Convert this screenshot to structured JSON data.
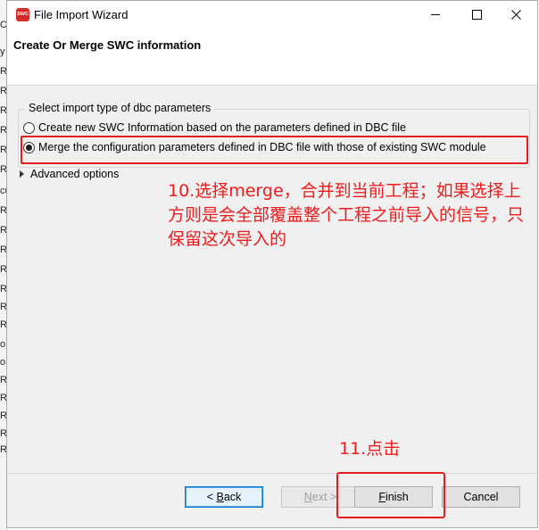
{
  "left_strip": {
    "fragments": [
      "C",
      "y",
      "R",
      "R",
      "R",
      "R",
      "R",
      "R",
      "cu",
      "R",
      "R",
      "R",
      "R",
      "R",
      "R",
      "R",
      "o",
      "o",
      "R",
      "R",
      "R",
      "R",
      "R"
    ]
  },
  "window": {
    "title": "File Import Wizard",
    "icon_text": "SWC"
  },
  "header": {
    "title": "Create Or Merge SWC information"
  },
  "import_group": {
    "label": "Select import type of dbc parameters",
    "options": [
      {
        "label": "Create new SWC Information based on the parameters defined in DBC file",
        "selected": false
      },
      {
        "label": "Merge the configuration parameters defined in DBC file with those of existing SWC module",
        "selected": true
      }
    ]
  },
  "advanced": {
    "label": "Advanced options"
  },
  "annotations": {
    "step10": "10.选择merge，合并到当前工程；如果选择上方则是会全部覆盖整个工程之前导入的信号，只保留这次导入的",
    "step11": "11.点击",
    "color": "#e51c1c"
  },
  "buttons": {
    "back_mnemonic": "B",
    "back_rest": "ack",
    "back_prefix": "< ",
    "next_mnemonic": "N",
    "next_rest": "ext >",
    "finish_mnemonic": "F",
    "finish_rest": "inish",
    "cancel": "Cancel"
  }
}
